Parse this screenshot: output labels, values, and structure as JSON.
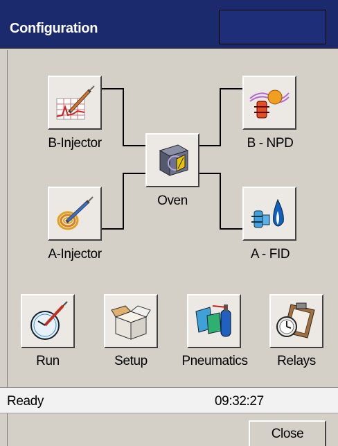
{
  "window": {
    "title": "Configuration"
  },
  "modules": {
    "b_injector": {
      "label": "B-Injector"
    },
    "oven": {
      "label": "Oven"
    },
    "b_detector": {
      "label": "B - NPD"
    },
    "a_injector": {
      "label": "A-Injector"
    },
    "a_detector": {
      "label": "A - FID"
    }
  },
  "toolbar": [
    {
      "label": "Run",
      "icon": "run-gauge-icon"
    },
    {
      "label": "Setup",
      "icon": "setup-box-icon"
    },
    {
      "label": "Pneumatics",
      "icon": "pneumatics-icon"
    },
    {
      "label": "Relays",
      "icon": "relays-clipboard-icon"
    }
  ],
  "status": {
    "text": "Ready",
    "time": "09:32:27"
  },
  "footer": {
    "close_label": "Close"
  },
  "colors": {
    "title_bg": "#1a2a6c",
    "panel_bg": "#d4d0c8",
    "status_bg": "#f2f2f2"
  }
}
